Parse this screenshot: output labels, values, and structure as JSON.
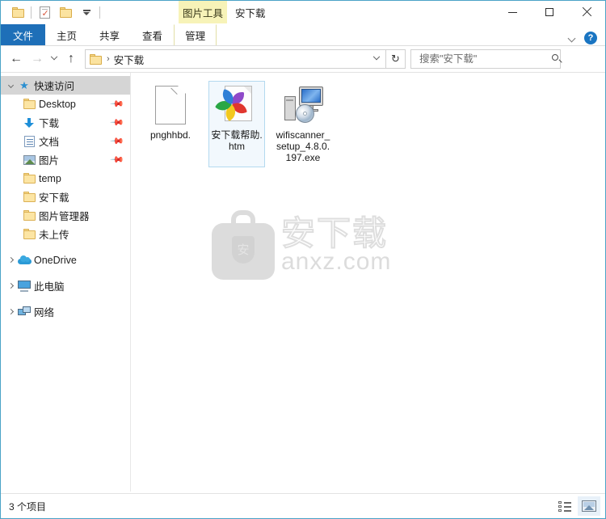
{
  "window": {
    "title": "安下载",
    "contextual_tab_group": "图片工具",
    "minimize_label": "—",
    "maximize_label": "☐",
    "close_label": "✕"
  },
  "quick_access_toolbar": {
    "items": [
      {
        "name": "properties-folder-icon",
        "label": ""
      },
      {
        "name": "new-folder-checked-icon",
        "label": ""
      },
      {
        "name": "new-folder-icon",
        "label": ""
      },
      {
        "name": "customize-qat-dropdown",
        "label": ""
      }
    ]
  },
  "ribbon": {
    "tabs": [
      {
        "label": "文件",
        "active": false,
        "is_file_tab": true
      },
      {
        "label": "主页",
        "active": false
      },
      {
        "label": "共享",
        "active": false
      },
      {
        "label": "查看",
        "active": false
      },
      {
        "label": "管理",
        "active": true,
        "contextual": true
      }
    ],
    "collapse_icon": "chevron-down-icon",
    "help_label": "?"
  },
  "navigation": {
    "back_label": "←",
    "forward_label": "→",
    "recent_label": "˅",
    "up_label": "↑",
    "address": {
      "crumb_separator": "›",
      "path_label": "安下载",
      "dropdown_icon": "chevron-down-icon"
    },
    "refresh_label": "↻"
  },
  "search": {
    "placeholder": "搜索\"安下载\"",
    "value": "",
    "icon": "search-icon"
  },
  "sidebar": {
    "items": [
      {
        "label": "快速访问",
        "icon": "pin-star-icon",
        "level": 0,
        "twisty": "open",
        "selected": true,
        "pinned": false
      },
      {
        "label": "Desktop",
        "icon": "folder-icon",
        "level": 1,
        "twisty": "none",
        "selected": false,
        "pinned": true
      },
      {
        "label": "下载",
        "icon": "downloads-icon",
        "level": 1,
        "twisty": "none",
        "selected": false,
        "pinned": true
      },
      {
        "label": "文档",
        "icon": "documents-icon",
        "level": 1,
        "twisty": "none",
        "selected": false,
        "pinned": true
      },
      {
        "label": "图片",
        "icon": "pictures-icon",
        "level": 1,
        "twisty": "none",
        "selected": false,
        "pinned": true
      },
      {
        "label": "temp",
        "icon": "folder-icon",
        "level": 1,
        "twisty": "none",
        "selected": false,
        "pinned": false
      },
      {
        "label": "安下载",
        "icon": "folder-icon",
        "level": 1,
        "twisty": "none",
        "selected": false,
        "pinned": false
      },
      {
        "label": "图片管理器",
        "icon": "folder-icon",
        "level": 1,
        "twisty": "none",
        "selected": false,
        "pinned": false
      },
      {
        "label": "未上传",
        "icon": "folder-icon",
        "level": 1,
        "twisty": "none",
        "selected": false,
        "pinned": false
      },
      {
        "label": "OneDrive",
        "icon": "onedrive-cloud-icon",
        "level": 0,
        "twisty": "closed",
        "selected": false,
        "pinned": false
      },
      {
        "label": "此电脑",
        "icon": "this-pc-icon",
        "level": 0,
        "twisty": "closed",
        "selected": false,
        "pinned": false
      },
      {
        "label": "网络",
        "icon": "network-icon",
        "level": 0,
        "twisty": "closed",
        "selected": false,
        "pinned": false
      }
    ]
  },
  "files": [
    {
      "name": "pnghhbd.",
      "icon": "blank-page-icon",
      "selected": false
    },
    {
      "name": "安下载帮助.htm",
      "icon": "html-document-icon",
      "selected": true
    },
    {
      "name": "wifiscanner_setup_4.8.0.197.exe",
      "icon": "installer-exe-icon",
      "selected": false
    }
  ],
  "watermark": {
    "cn_text": "安下载",
    "en_text": "anxz.com",
    "shield_char": "安"
  },
  "status": {
    "item_count_text": "3 个项目",
    "views": [
      {
        "name": "details-view-button",
        "active": false
      },
      {
        "name": "large-icons-view-button",
        "active": true
      }
    ]
  },
  "colors": {
    "file_tab_blue": "#1e6fb8",
    "contextual_yellow": "#f7f3b8",
    "selection_blue": "#b4d9ef",
    "window_border": "#4ba3c7"
  }
}
